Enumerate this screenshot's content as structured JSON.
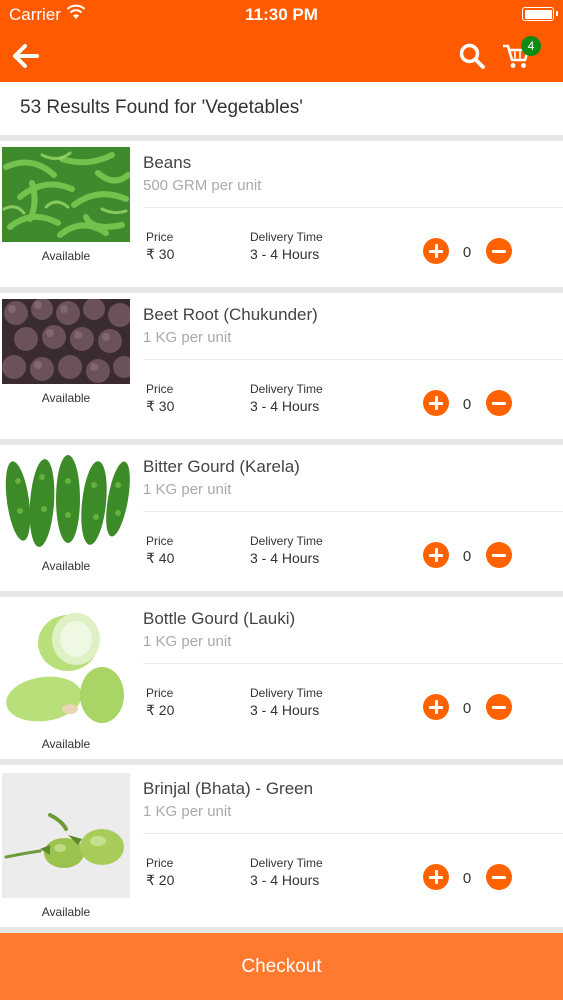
{
  "status_bar": {
    "carrier": "Carrier",
    "time": "11:30 PM"
  },
  "header": {
    "back_icon": "arrow-left-icon",
    "search_icon": "search-icon",
    "cart_icon": "cart-icon",
    "cart_count": "4"
  },
  "results_text": "53 Results Found for 'Vegetables'",
  "price_label": "Price",
  "delivery_label": "Delivery Time",
  "items": [
    {
      "name": "Beans",
      "unit": "500 GRM per unit",
      "availability": "Available",
      "price": "₹ 30",
      "delivery": "3 - 4 Hours",
      "quantity": "0"
    },
    {
      "name": "Beet Root (Chukunder)",
      "unit": "1 KG per unit",
      "availability": "Available",
      "price": "₹ 30",
      "delivery": "3 - 4 Hours",
      "quantity": "0"
    },
    {
      "name": "Bitter Gourd (Karela)",
      "unit": "1 KG per unit",
      "availability": "Available",
      "price": "₹ 40",
      "delivery": "3 - 4 Hours",
      "quantity": "0"
    },
    {
      "name": "Bottle Gourd (Lauki)",
      "unit": "1 KG per unit",
      "availability": "Available",
      "price": "₹ 20",
      "delivery": "3 - 4 Hours",
      "quantity": "0"
    },
    {
      "name": "Brinjal (Bhata) - Green",
      "unit": "1 KG per unit",
      "availability": "Available",
      "price": "₹ 20",
      "delivery": "3 - 4 Hours",
      "quantity": "0"
    }
  ],
  "checkout_label": "Checkout",
  "colors": {
    "brand": "#ff5a00",
    "button": "#ff6200",
    "checkout": "#ff7a2e",
    "badge": "#0e8a16"
  }
}
